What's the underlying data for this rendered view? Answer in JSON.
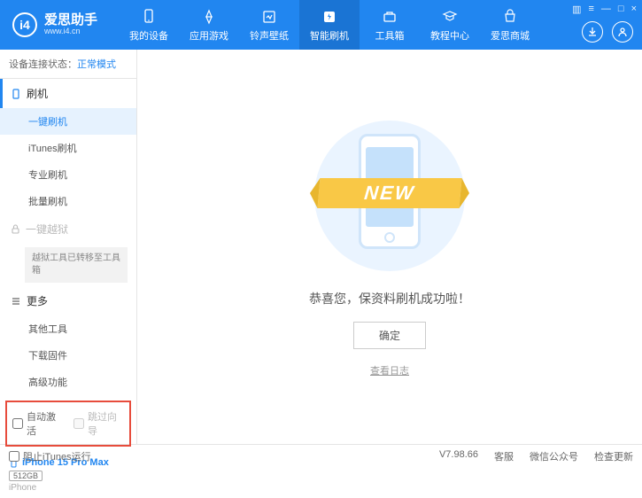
{
  "header": {
    "logo_title": "爱思助手",
    "logo_sub": "www.i4.cn",
    "nav": [
      {
        "label": "我的设备"
      },
      {
        "label": "应用游戏"
      },
      {
        "label": "铃声壁纸"
      },
      {
        "label": "智能刷机"
      },
      {
        "label": "工具箱"
      },
      {
        "label": "教程中心"
      },
      {
        "label": "爱思商城"
      }
    ],
    "win": {
      "list": "▥",
      "tri": "≡",
      "min": "—",
      "max": "□",
      "close": "×"
    }
  },
  "sidebar": {
    "status_label": "设备连接状态：",
    "status_mode": "正常模式",
    "groups": {
      "flash": {
        "title": "刷机",
        "items": [
          "一键刷机",
          "iTunes刷机",
          "专业刷机",
          "批量刷机"
        ]
      },
      "jailbreak": {
        "title": "一键越狱",
        "note": "越狱工具已转移至工具箱"
      },
      "more": {
        "title": "更多",
        "items": [
          "其他工具",
          "下载固件",
          "高级功能"
        ]
      }
    },
    "checkboxes": {
      "auto_activate": "自动激活",
      "skip_guide": "跳过向导"
    },
    "device": {
      "name": "iPhone 15 Pro Max",
      "storage": "512GB",
      "model": "iPhone"
    }
  },
  "main": {
    "banner": "NEW",
    "message": "恭喜您，保资料刷机成功啦！",
    "ok": "确定",
    "log": "查看日志"
  },
  "statusbar": {
    "block_itunes": "阻止iTunes运行",
    "version": "V7.98.66",
    "links": [
      "客服",
      "微信公众号",
      "检查更新"
    ]
  }
}
